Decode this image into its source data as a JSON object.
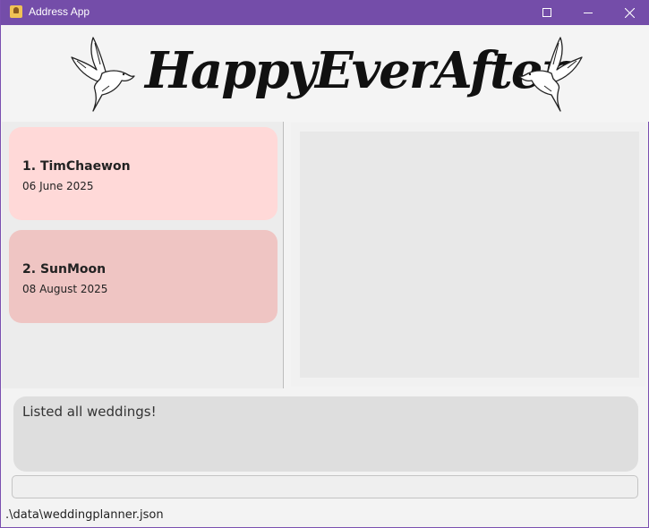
{
  "window": {
    "title": "Address App",
    "controls": [
      "minimize-icon",
      "maximize-icon",
      "close-icon"
    ],
    "title_bar_color": "#744da9"
  },
  "header": {
    "logo_text": "HappyEverAfter",
    "decorations": [
      "dove-icon",
      "dove-icon"
    ]
  },
  "weddings": [
    {
      "index": "1.",
      "name": "TimChaewon",
      "date": "06 June 2025",
      "color": "#ffd9d8"
    },
    {
      "index": "2.",
      "name": "SunMoon",
      "date": "08 August 2025",
      "color": "#efc5c3"
    }
  ],
  "result_display": {
    "message": "Listed all weddings!"
  },
  "command_box": {
    "value": "",
    "placeholder": ""
  },
  "status_bar": {
    "file_path": ".\\data\\weddingplanner.json"
  }
}
